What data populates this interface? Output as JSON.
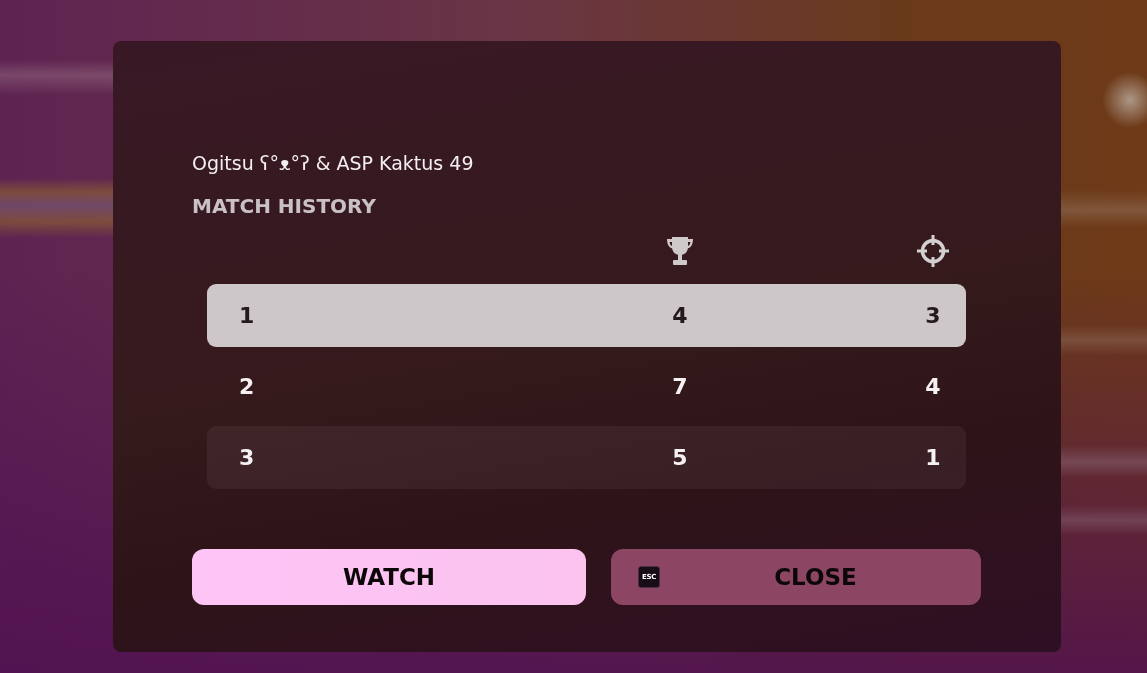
{
  "dialog": {
    "title": "Ogitsu ʕ°ᴥ°ʔ & ASP Kaktus 49",
    "heading": "MATCH HISTORY",
    "table": {
      "rows": [
        {
          "cells": [
            "1",
            "4",
            "3"
          ],
          "selected": true
        },
        {
          "cells": [
            "2",
            "7",
            "4"
          ],
          "selected": false
        },
        {
          "cells": [
            "3",
            "5",
            "1"
          ],
          "selected": false
        }
      ]
    },
    "buttons": [
      {
        "kind": "primary",
        "label": "WATCH"
      },
      {
        "kind": "secondary",
        "label": "CLOSE",
        "key_hint": "ESC"
      }
    ]
  }
}
